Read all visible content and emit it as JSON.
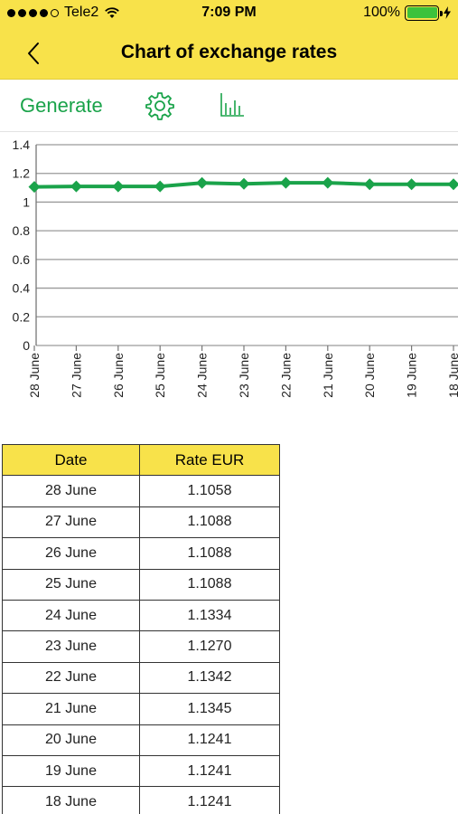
{
  "status_bar": {
    "carrier": "Tele2",
    "time": "7:09 PM",
    "battery": "100%"
  },
  "nav": {
    "title": "Chart of exchange rates",
    "back_icon": "chevron-left-icon"
  },
  "toolbar": {
    "generate_label": "Generate",
    "settings_icon": "gear-icon",
    "chart_icon": "bar-chart-icon"
  },
  "colors": {
    "accent": "#1aa34a",
    "header": "#f8e24a",
    "line": "#1aa34a"
  },
  "chart_data": {
    "type": "line",
    "categories": [
      "28 June",
      "27 June",
      "26 June",
      "25 June",
      "24 June",
      "23 June",
      "22 June",
      "21 June",
      "20 June",
      "19 June",
      "18 June"
    ],
    "values": [
      1.1058,
      1.1088,
      1.1088,
      1.1088,
      1.1334,
      1.127,
      1.1342,
      1.1345,
      1.1241,
      1.1241,
      1.1241
    ],
    "ylim": [
      0,
      1.4
    ],
    "yticks": [
      "1.4",
      "1.2",
      "1",
      "0.8",
      "0.6",
      "0.4",
      "0.2",
      "0"
    ],
    "ytick_values": [
      1.4,
      1.2,
      1.0,
      0.8,
      0.6,
      0.4,
      0.2,
      0
    ],
    "grid": true,
    "marker": "diamond"
  },
  "table": {
    "headers": [
      "Date",
      "Rate EUR"
    ],
    "rows": [
      [
        "28 June",
        "1.1058"
      ],
      [
        "27 June",
        "1.1088"
      ],
      [
        "26 June",
        "1.1088"
      ],
      [
        "25 June",
        "1.1088"
      ],
      [
        "24 June",
        "1.1334"
      ],
      [
        "23 June",
        "1.1270"
      ],
      [
        "22 June",
        "1.1342"
      ],
      [
        "21 June",
        "1.1345"
      ],
      [
        "20 June",
        "1.1241"
      ],
      [
        "19 June",
        "1.1241"
      ],
      [
        "18 June",
        "1.1241"
      ]
    ]
  }
}
